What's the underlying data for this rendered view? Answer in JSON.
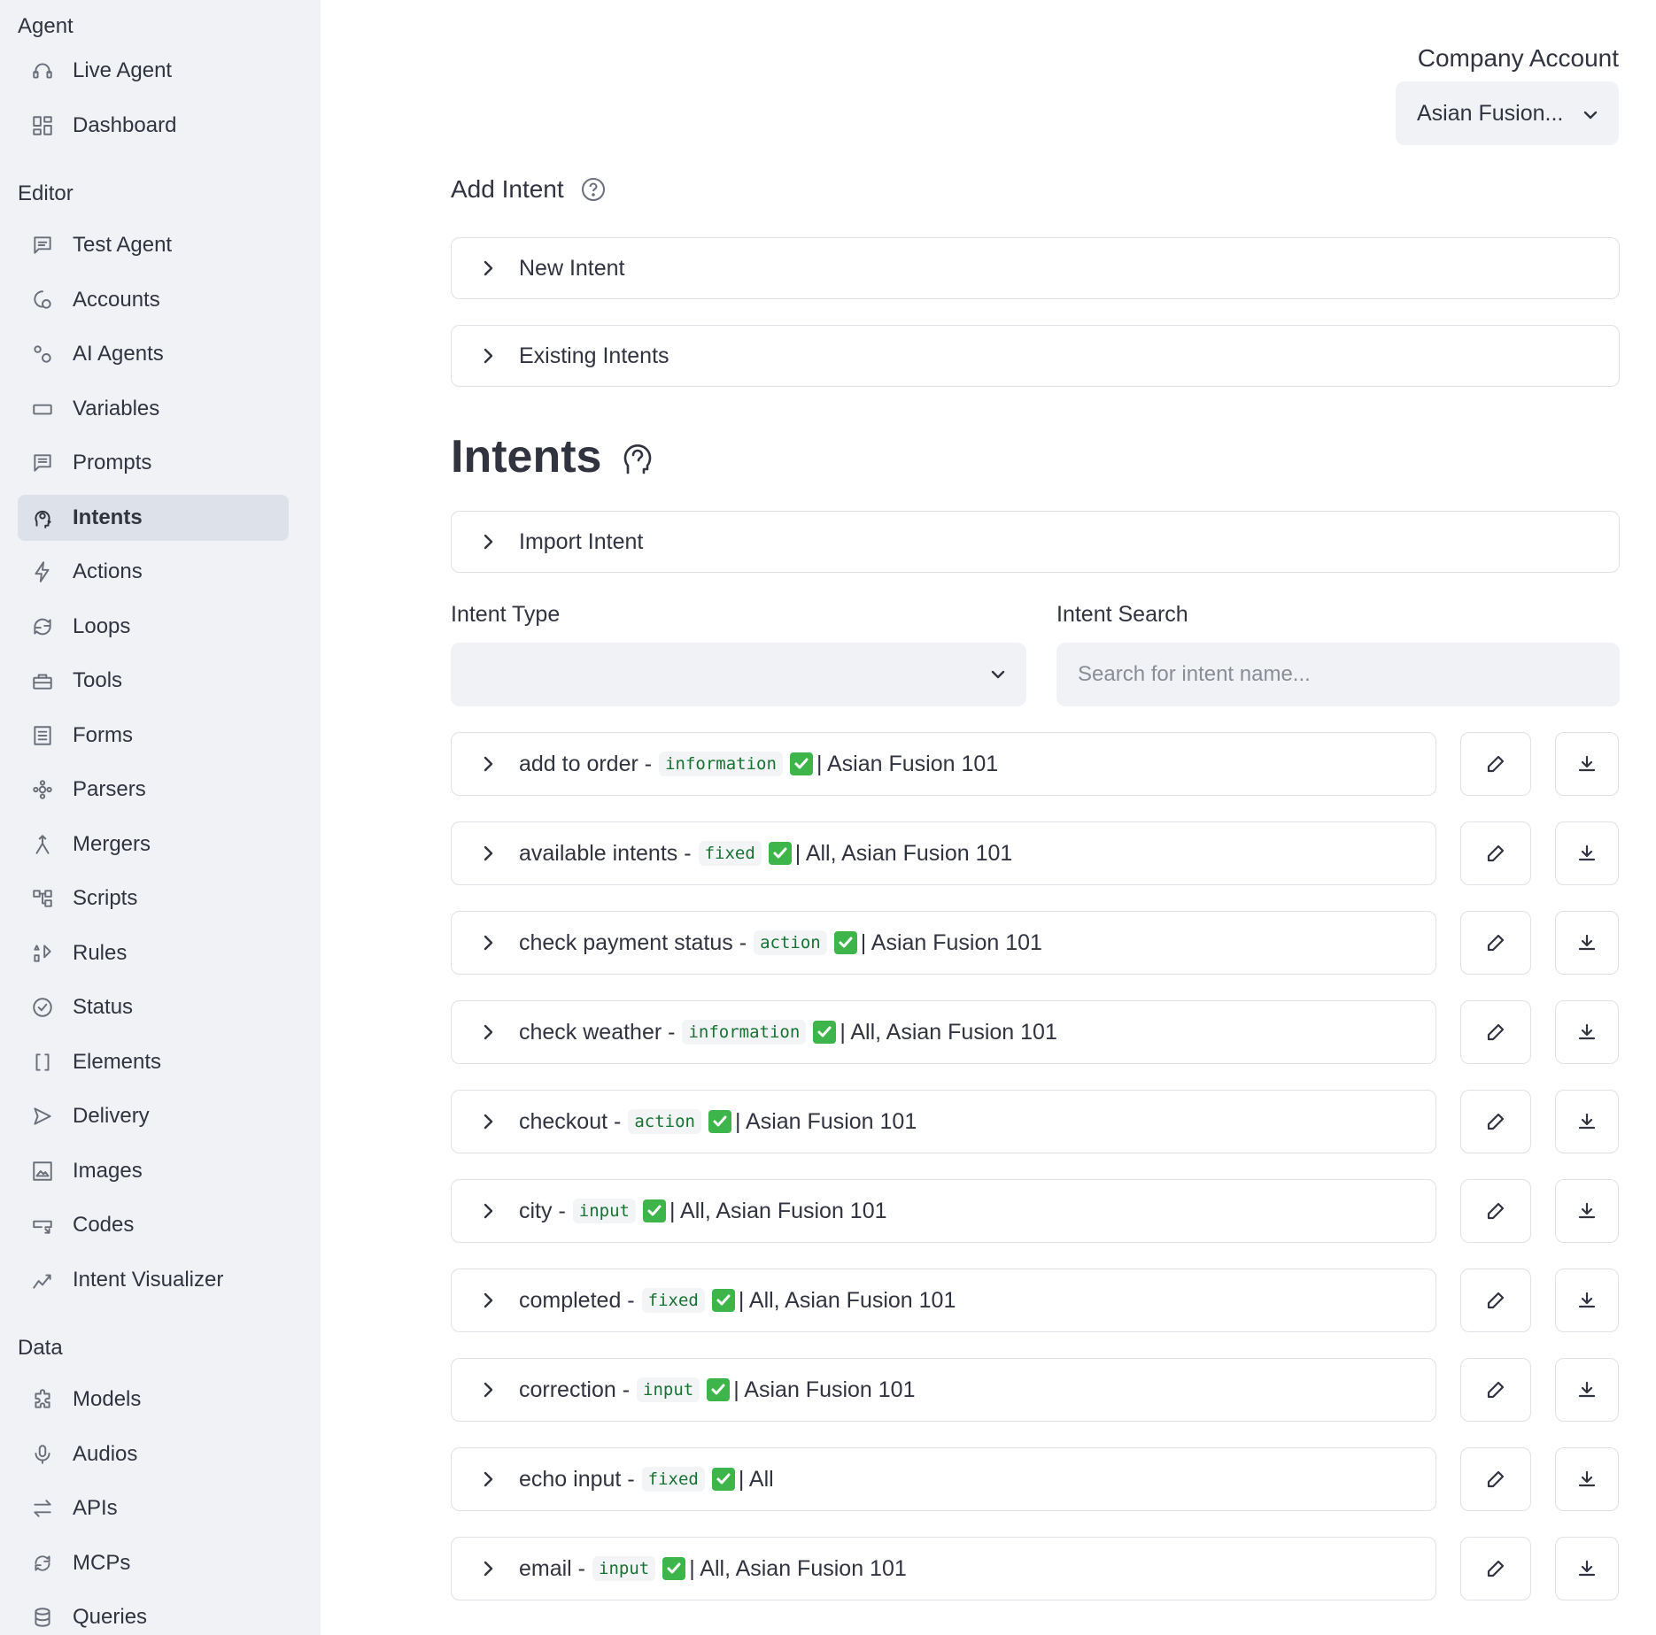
{
  "sidebar": {
    "sections": [
      {
        "title": "Agent",
        "items": [
          {
            "label": "Live Agent",
            "icon": "headset-icon"
          },
          {
            "label": "Dashboard",
            "icon": "dashboard-icon"
          }
        ]
      },
      {
        "title": "Editor",
        "items": [
          {
            "label": "Test Agent",
            "icon": "chat-icon"
          },
          {
            "label": "Accounts",
            "icon": "account-icon"
          },
          {
            "label": "AI Agents",
            "icon": "gears-icon"
          },
          {
            "label": "Variables",
            "icon": "rectangle-icon"
          },
          {
            "label": "Prompts",
            "icon": "message-icon"
          },
          {
            "label": "Intents",
            "icon": "head-icon",
            "active": true
          },
          {
            "label": "Actions",
            "icon": "bolt-icon"
          },
          {
            "label": "Loops",
            "icon": "loop-icon"
          },
          {
            "label": "Tools",
            "icon": "toolbox-icon"
          },
          {
            "label": "Forms",
            "icon": "form-icon"
          },
          {
            "label": "Parsers",
            "icon": "parser-icon"
          },
          {
            "label": "Mergers",
            "icon": "merge-icon"
          },
          {
            "label": "Scripts",
            "icon": "schema-icon"
          },
          {
            "label": "Rules",
            "icon": "rules-icon"
          },
          {
            "label": "Status",
            "icon": "check-circle-icon"
          },
          {
            "label": "Elements",
            "icon": "brackets-icon"
          },
          {
            "label": "Delivery",
            "icon": "send-icon"
          },
          {
            "label": "Images",
            "icon": "image-icon"
          },
          {
            "label": "Codes",
            "icon": "code-icon"
          },
          {
            "label": "Intent Visualizer",
            "icon": "chart-icon"
          }
        ]
      },
      {
        "title": "Data",
        "items": [
          {
            "label": "Models",
            "icon": "puzzle-icon"
          },
          {
            "label": "Audios",
            "icon": "mic-icon"
          },
          {
            "label": "APIs",
            "icon": "swap-icon"
          },
          {
            "label": "MCPs",
            "icon": "sync-icon"
          },
          {
            "label": "Queries",
            "icon": "database-icon"
          }
        ]
      }
    ]
  },
  "header": {
    "company_label": "Company Account",
    "company_value": "Asian Fusion..."
  },
  "add_intent": {
    "title": "Add Intent",
    "new_intent": "New Intent",
    "existing_intents": "Existing Intents"
  },
  "intents": {
    "title": "Intents",
    "import_intent": "Import Intent",
    "type_label": "Intent Type",
    "search_label": "Intent Search",
    "search_placeholder": "Search for intent name...",
    "rows": [
      {
        "name": "add to order -",
        "type": "information",
        "accounts": "| Asian Fusion 101"
      },
      {
        "name": "available intents -",
        "type": "fixed",
        "accounts": "| All, Asian Fusion 101"
      },
      {
        "name": "check payment status -",
        "type": "action",
        "accounts": "| Asian Fusion 101"
      },
      {
        "name": "check weather -",
        "type": "information",
        "accounts": "| All, Asian Fusion 101"
      },
      {
        "name": "checkout -",
        "type": "action",
        "accounts": "| Asian Fusion 101"
      },
      {
        "name": "city -",
        "type": "input",
        "accounts": "| All, Asian Fusion 101"
      },
      {
        "name": "completed -",
        "type": "fixed",
        "accounts": "| All, Asian Fusion 101"
      },
      {
        "name": "correction -",
        "type": "input",
        "accounts": "| Asian Fusion 101"
      },
      {
        "name": "echo input -",
        "type": "fixed",
        "accounts": "| All"
      },
      {
        "name": "email -",
        "type": "input",
        "accounts": "| All, Asian Fusion 101"
      }
    ]
  }
}
